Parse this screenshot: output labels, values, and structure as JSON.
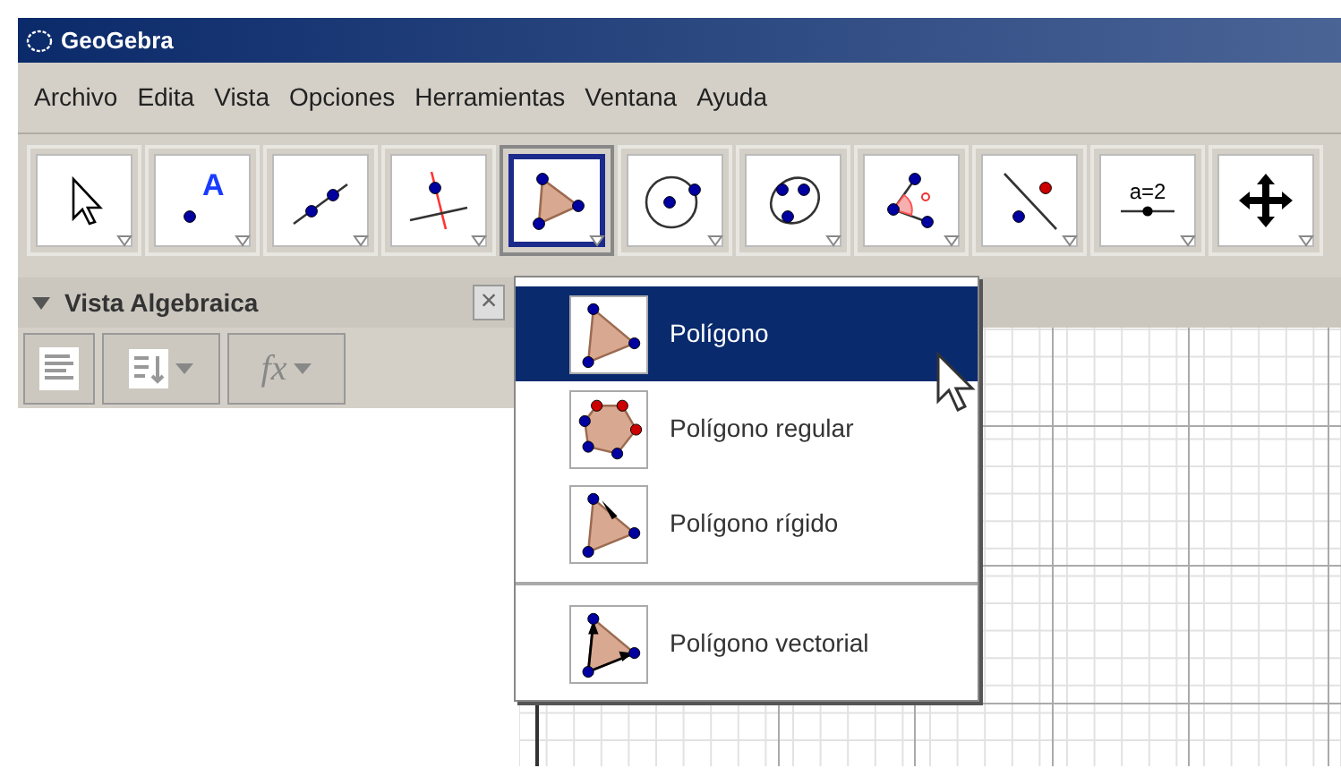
{
  "window": {
    "title": "GeoGebra"
  },
  "menu": [
    "Archivo",
    "Edita",
    "Vista",
    "Opciones",
    "Herramientas",
    "Ventana",
    "Ayuda"
  ],
  "tools": [
    {
      "kind": "pointer",
      "selected": false
    },
    {
      "kind": "point",
      "selected": false,
      "label": "A"
    },
    {
      "kind": "line",
      "selected": false
    },
    {
      "kind": "perpendicular",
      "selected": false
    },
    {
      "kind": "polygon",
      "selected": true
    },
    {
      "kind": "circle",
      "selected": false
    },
    {
      "kind": "conic",
      "selected": false
    },
    {
      "kind": "angle",
      "selected": false
    },
    {
      "kind": "reflect",
      "selected": false
    },
    {
      "kind": "slider",
      "selected": false,
      "label": "a=2"
    },
    {
      "kind": "move",
      "selected": false
    }
  ],
  "algebra_view": {
    "title": "Vista Algebraica",
    "close": "×",
    "fx": "fx"
  },
  "dropdown": [
    {
      "label": "Polígono",
      "kind": "polygon",
      "selected": true,
      "separator_before": false
    },
    {
      "label": "Polígono regular",
      "kind": "regular",
      "selected": false,
      "separator_before": false
    },
    {
      "label": "Polígono rígido",
      "kind": "rigid",
      "selected": false,
      "separator_before": false
    },
    {
      "label": "Polígono vectorial",
      "kind": "vector",
      "selected": false,
      "separator_before": true
    }
  ]
}
